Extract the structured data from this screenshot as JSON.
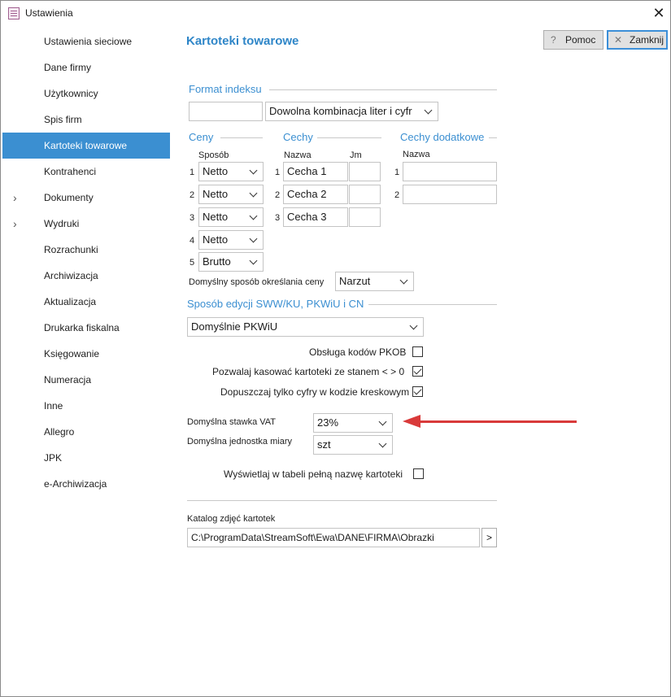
{
  "window": {
    "title": "Ustawienia"
  },
  "sidebar": {
    "items": [
      {
        "label": "Ustawienia sieciowe"
      },
      {
        "label": "Dane firmy"
      },
      {
        "label": "Użytkownicy"
      },
      {
        "label": "Spis firm"
      },
      {
        "label": "Kartoteki towarowe",
        "active": true
      },
      {
        "label": "Kontrahenci"
      },
      {
        "label": "Dokumenty",
        "expandable": true
      },
      {
        "label": "Wydruki",
        "expandable": true
      },
      {
        "label": "Rozrachunki"
      },
      {
        "label": "Archiwizacja"
      },
      {
        "label": "Aktualizacja"
      },
      {
        "label": "Drukarka fiskalna"
      },
      {
        "label": "Księgowanie"
      },
      {
        "label": "Numeracja"
      },
      {
        "label": "Inne"
      },
      {
        "label": "Allegro"
      },
      {
        "label": "JPK"
      },
      {
        "label": "e-Archiwizacja"
      }
    ]
  },
  "header": {
    "title": "Kartoteki towarowe",
    "help_label": "Pomoc",
    "close_label": "Zamknij"
  },
  "format_indeksu": {
    "section_label": "Format indeksu",
    "prefix_value": "",
    "combo_value": "Dowolna kombinacja liter i cyfr"
  },
  "ceny": {
    "section_label": "Ceny",
    "col_header": "Sposób",
    "rows": [
      {
        "num": "1",
        "value": "Netto"
      },
      {
        "num": "2",
        "value": "Netto"
      },
      {
        "num": "3",
        "value": "Netto"
      },
      {
        "num": "4",
        "value": "Netto"
      },
      {
        "num": "5",
        "value": "Brutto"
      }
    ]
  },
  "cechy": {
    "section_label": "Cechy",
    "col_name": "Nazwa",
    "col_jm": "Jm",
    "rows": [
      {
        "num": "1",
        "name": "Cecha 1",
        "jm": ""
      },
      {
        "num": "2",
        "name": "Cecha 2",
        "jm": ""
      },
      {
        "num": "3",
        "name": "Cecha 3",
        "jm": ""
      }
    ]
  },
  "cechy_dodatkowe": {
    "section_label": "Cechy dodatkowe",
    "col_name": "Nazwa",
    "rows": [
      {
        "num": "1",
        "name": ""
      },
      {
        "num": "2",
        "name": ""
      }
    ]
  },
  "price_method": {
    "label": "Domyślny sposób określania ceny",
    "value": "Narzut"
  },
  "sww": {
    "section_label": "Sposób edycji SWW/KU, PKWiU  i CN",
    "value": "Domyślnie PKWiU"
  },
  "options": [
    {
      "label": "Obsługa kodów PKOB",
      "checked": false
    },
    {
      "label": "Pozwalaj kasować kartoteki ze stanem < > 0",
      "checked": true
    },
    {
      "label": "Dopuszczaj tylko cyfry w kodzie kreskowym",
      "checked": true
    }
  ],
  "vat": {
    "label": "Domyślna stawka VAT",
    "value": "23%"
  },
  "unit": {
    "label": "Domyślna jednostka miary",
    "value": "szt"
  },
  "full_name_option": {
    "label": "Wyświetlaj w tabeli pełną nazwę kartoteki",
    "checked": false
  },
  "photo_catalog": {
    "label": "Katalog zdjęć kartotek",
    "path": "C:\\ProgramData\\StreamSoft\\Ewa\\DANE\\FIRMA\\Obrazki",
    "browse_label": ">"
  },
  "colors": {
    "accent": "#3b8fd1",
    "annotation_arrow": "#d93a3a"
  }
}
